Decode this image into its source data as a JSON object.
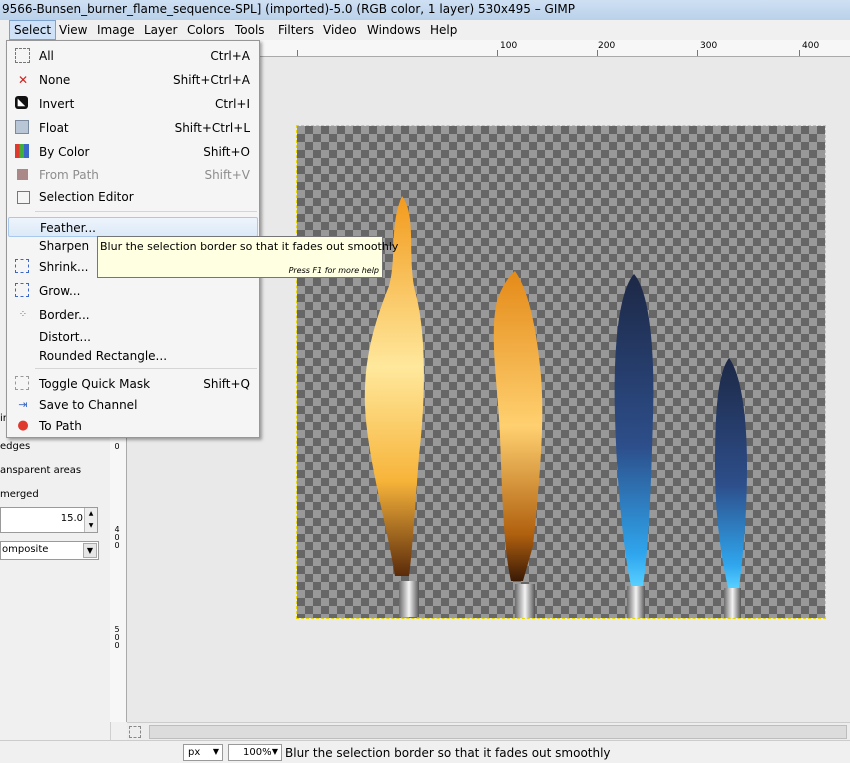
{
  "window": {
    "title": "9566-Bunsen_burner_flame_sequence-SPL] (imported)-5.0 (RGB color, 1 layer) 530x495 – GIMP"
  },
  "menubar": [
    "Select",
    "View",
    "Image",
    "Layer",
    "Colors",
    "Tools",
    "Filters",
    "Video",
    "Windows",
    "Help"
  ],
  "select_menu": {
    "items": [
      {
        "label": "All",
        "shortcut": "Ctrl+A",
        "icon": "select-all-icon"
      },
      {
        "label": "None",
        "shortcut": "Shift+Ctrl+A",
        "icon": "select-none-icon"
      },
      {
        "label": "Invert",
        "shortcut": "Ctrl+I",
        "icon": "invert-icon"
      },
      {
        "label": "Float",
        "shortcut": "Shift+Ctrl+L",
        "icon": "float-icon"
      },
      {
        "label": "By Color",
        "shortcut": "Shift+O",
        "icon": "by-color-icon"
      },
      {
        "label": "From Path",
        "shortcut": "Shift+V",
        "icon": "from-path-icon"
      },
      {
        "label": "Selection Editor",
        "shortcut": "",
        "icon": "selection-editor-icon"
      },
      {
        "label": "Feather...",
        "shortcut": "",
        "icon": ""
      },
      {
        "label": "Sharpen",
        "shortcut": "",
        "icon": ""
      },
      {
        "label": "Shrink...",
        "shortcut": "",
        "icon": "shrink-icon"
      },
      {
        "label": "Grow...",
        "shortcut": "",
        "icon": "grow-icon"
      },
      {
        "label": "Border...",
        "shortcut": "",
        "icon": "border-icon"
      },
      {
        "label": "Distort...",
        "shortcut": "",
        "icon": ""
      },
      {
        "label": "Rounded Rectangle...",
        "shortcut": "",
        "icon": ""
      },
      {
        "label": "Toggle Quick Mask",
        "shortcut": "Shift+Q",
        "icon": "quick-mask-icon"
      },
      {
        "label": "Save to Channel",
        "shortcut": "",
        "icon": "save-channel-icon"
      },
      {
        "label": "To Path",
        "shortcut": "",
        "icon": "to-path-icon"
      }
    ]
  },
  "tooltip": {
    "text": "Blur the selection border so that it fades out smoothly",
    "hint": "Press F1 for more help"
  },
  "tool_options": {
    "edges": "edges",
    "transparent": "ansparent areas",
    "merged": "merged",
    "in": "in",
    "radius_value": "15.0",
    "mode_value": "omposite"
  },
  "rulers": {
    "h_labels": [
      "100",
      "200",
      "300",
      "400"
    ],
    "v_labels": [
      "4\n0\n0",
      "5\n0\n0",
      "0"
    ]
  },
  "statusbar": {
    "unit": "px",
    "zoom": "100%",
    "message": "Blur the selection border so that it fades out smoothly"
  }
}
